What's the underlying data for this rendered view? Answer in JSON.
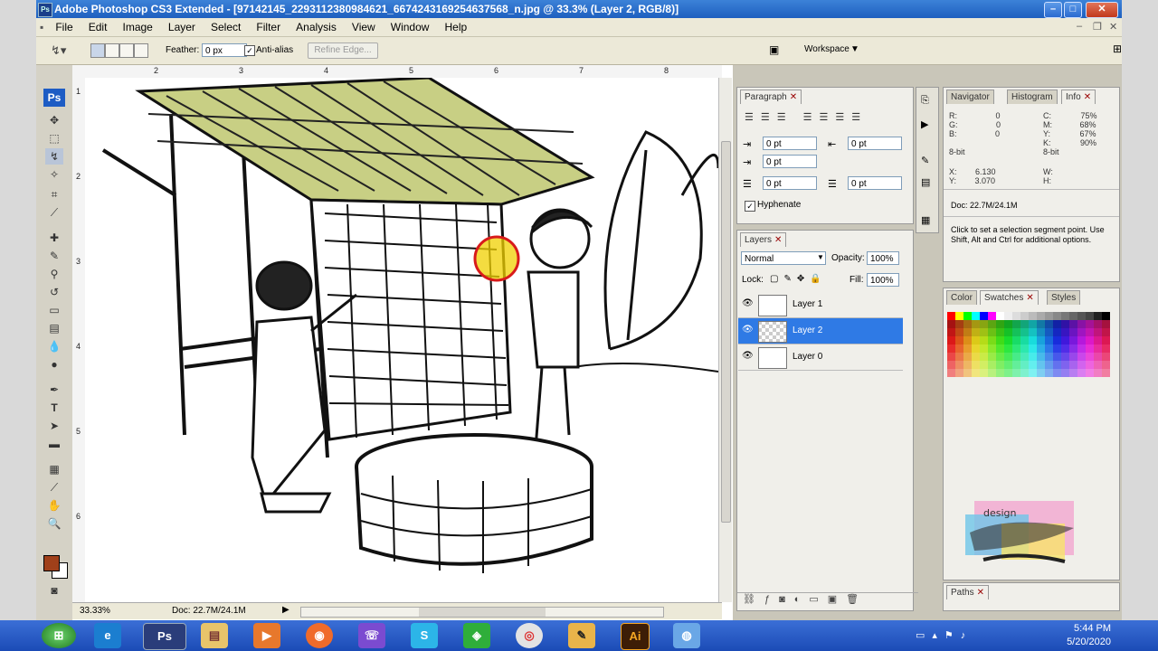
{
  "app": {
    "title": "Adobe Photoshop CS3 Extended - [97142145_2293112380984621_6674243169254637568_n.jpg @ 33.3% (Layer 2, RGB/8)]",
    "logo": "Ps"
  },
  "menu": [
    "File",
    "Edit",
    "Image",
    "Layer",
    "Select",
    "Filter",
    "Analysis",
    "View",
    "Window",
    "Help"
  ],
  "options": {
    "feather_label": "Feather:",
    "feather_value": "0 px",
    "antialias_label": "Anti-alias",
    "refine_label": "Refine Edge...",
    "workspace_label": "Workspace"
  },
  "rulers": {
    "top": [
      "2",
      "3",
      "4",
      "5",
      "6",
      "7",
      "8"
    ],
    "left": [
      "1",
      "2",
      "3",
      "4",
      "5",
      "6"
    ]
  },
  "status": {
    "zoom": "33.33%",
    "doc": "Doc: 22.7M/24.1M"
  },
  "paragraph": {
    "tab": "Paragraph",
    "indent_left": "0 pt",
    "indent_right": "0 pt",
    "indent_first": "0 pt",
    "space_before": "0 pt",
    "space_after": "0 pt",
    "hyphenate": "Hyphenate"
  },
  "layers": {
    "tab": "Layers",
    "blend_mode": "Normal",
    "opacity_label": "Opacity:",
    "opacity": "100%",
    "lock_label": "Lock:",
    "fill_label": "Fill:",
    "fill": "100%",
    "items": [
      {
        "name": "Layer 1",
        "selected": false
      },
      {
        "name": "Layer 2",
        "selected": true
      },
      {
        "name": "Layer 0",
        "selected": false
      }
    ]
  },
  "info": {
    "tabs": [
      "Navigator",
      "Histogram",
      "Info"
    ],
    "r_label": "R:",
    "r": "0",
    "g_label": "G:",
    "g": "0",
    "b_label": "B:",
    "b": "0",
    "c_label": "C:",
    "c": "75%",
    "m_label": "M:",
    "m": "68%",
    "y_label": "Y:",
    "y": "67%",
    "k_label": "K:",
    "k": "90%",
    "bit_left": "8-bit",
    "bit_right": "8-bit",
    "x_label": "X:",
    "x": "6.130",
    "yy_label": "Y:",
    "yy": "3.070",
    "w_label": "W:",
    "h_label": "H:",
    "doc": "Doc: 22.7M/24.1M",
    "hint": "Click to set a selection segment point. Use Shift, Alt and Ctrl for additional options."
  },
  "color_panel": {
    "tabs": [
      "Color",
      "Swatches",
      "Styles"
    ]
  },
  "paths_tab": "Paths",
  "watermark": "design",
  "taskbar": {
    "time": "5:44 PM",
    "date": "5/20/2020",
    "ai_label": "Ai"
  },
  "colors": {
    "titlebar": "#2a6ad0",
    "selected_layer": "#2f7ae5",
    "foreground": "#a0401a",
    "thatch": "#c8cf84"
  }
}
